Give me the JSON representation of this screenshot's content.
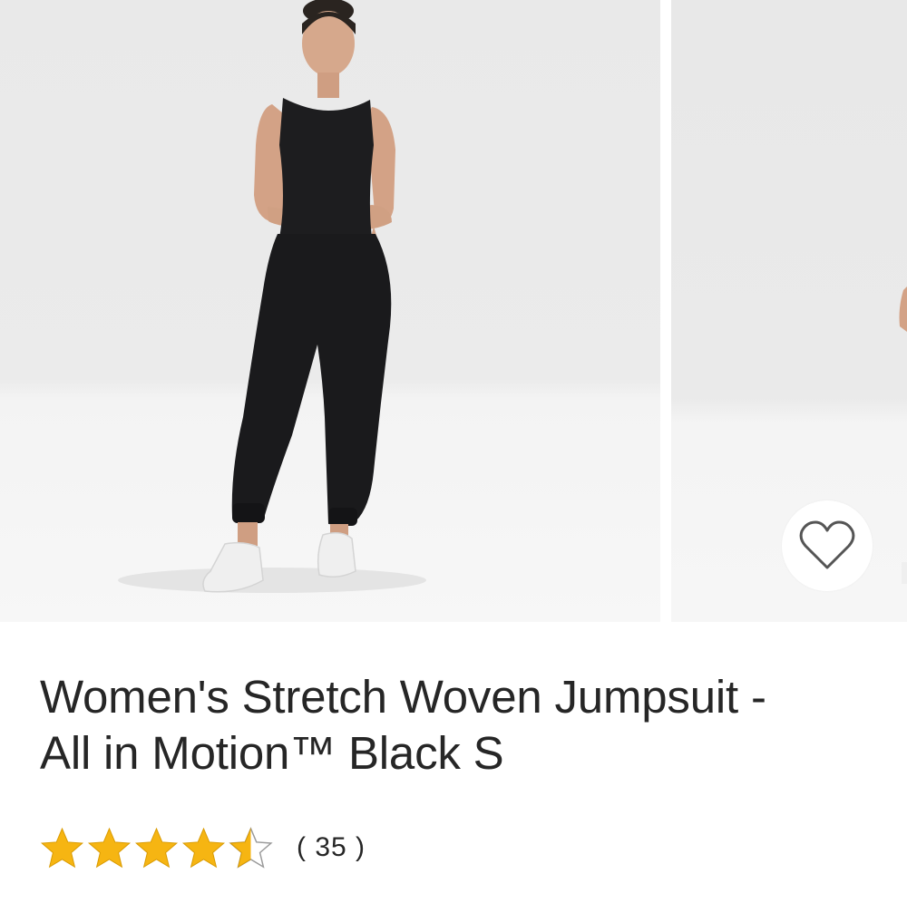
{
  "product": {
    "title_line_1": "Women's Stretch Woven Jumpsuit -",
    "title_line_2": "All in Motion™ Black S",
    "rating": {
      "value": 4.5,
      "max": 5,
      "review_count_text": "( 35 )"
    }
  },
  "gallery": {
    "images": [
      {
        "description_icon": "product-photo",
        "selected": true
      },
      {
        "description_icon": "product-photo",
        "selected": false
      }
    ]
  },
  "icons": {
    "favorite": "heart-outline-icon",
    "star": "star-icon"
  },
  "colors": {
    "star_fill": "#f6b512",
    "star_outline": "#9a9a9a",
    "text": "#262626",
    "heart_stroke": "#555555"
  }
}
